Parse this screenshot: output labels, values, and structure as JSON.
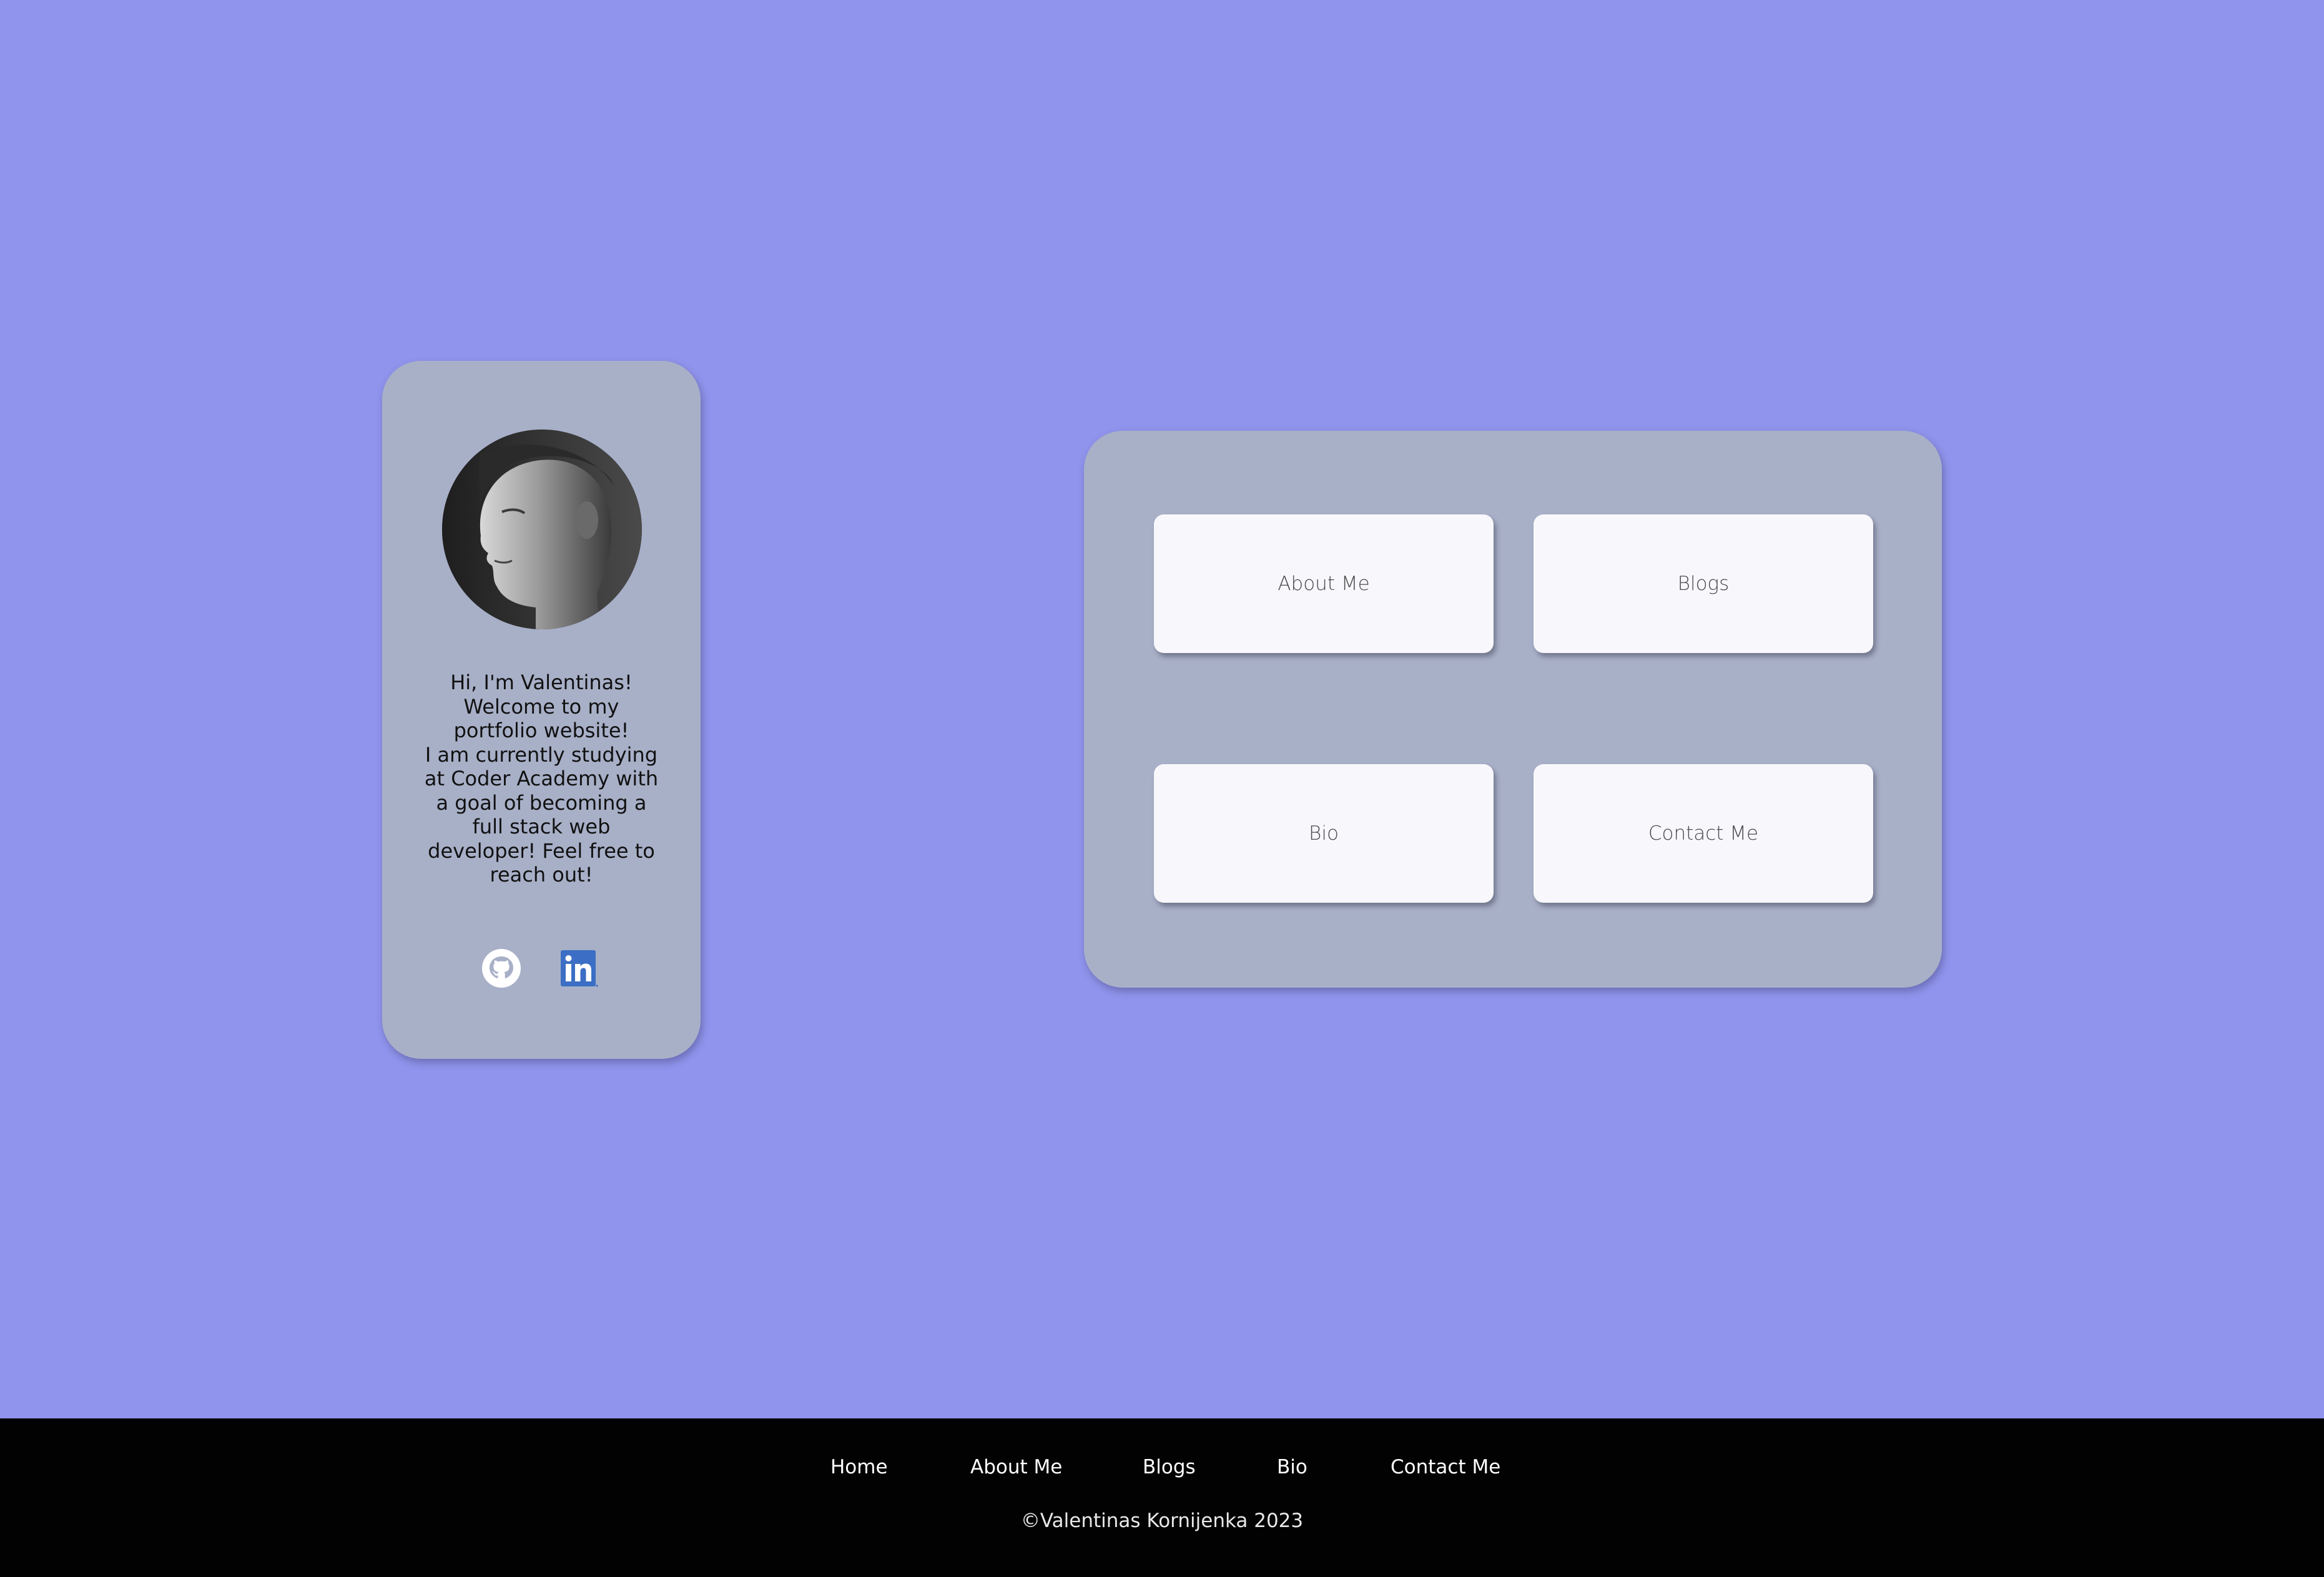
{
  "colors": {
    "page_background": "#9094ec",
    "card_background": "#a8b0c8",
    "nav_card_background": "#f8f7fc",
    "footer_background": "#020202",
    "linkedin_blue": "#3b6ec4"
  },
  "profile": {
    "avatar_icon": "profile-photo",
    "bio_lines": [
      "Hi, I'm Valentinas!",
      "Welcome to my",
      "portfolio website!",
      "I am currently studying",
      "at Coder Academy with",
      "a goal of becoming a",
      "full stack web",
      "developer! Feel free to",
      "reach out!"
    ],
    "social": [
      {
        "name": "GitHub",
        "icon": "github-icon"
      },
      {
        "name": "LinkedIn",
        "icon": "linkedin-icon"
      }
    ]
  },
  "nav_cards": [
    {
      "label": "About Me"
    },
    {
      "label": "Blogs"
    },
    {
      "label": "Bio"
    },
    {
      "label": "Contact Me"
    }
  ],
  "footer": {
    "links": [
      {
        "label": "Home"
      },
      {
        "label": "About Me"
      },
      {
        "label": "Blogs"
      },
      {
        "label": "Bio"
      },
      {
        "label": "Contact Me"
      }
    ],
    "copyright": "©Valentinas Kornijenka 2023"
  }
}
